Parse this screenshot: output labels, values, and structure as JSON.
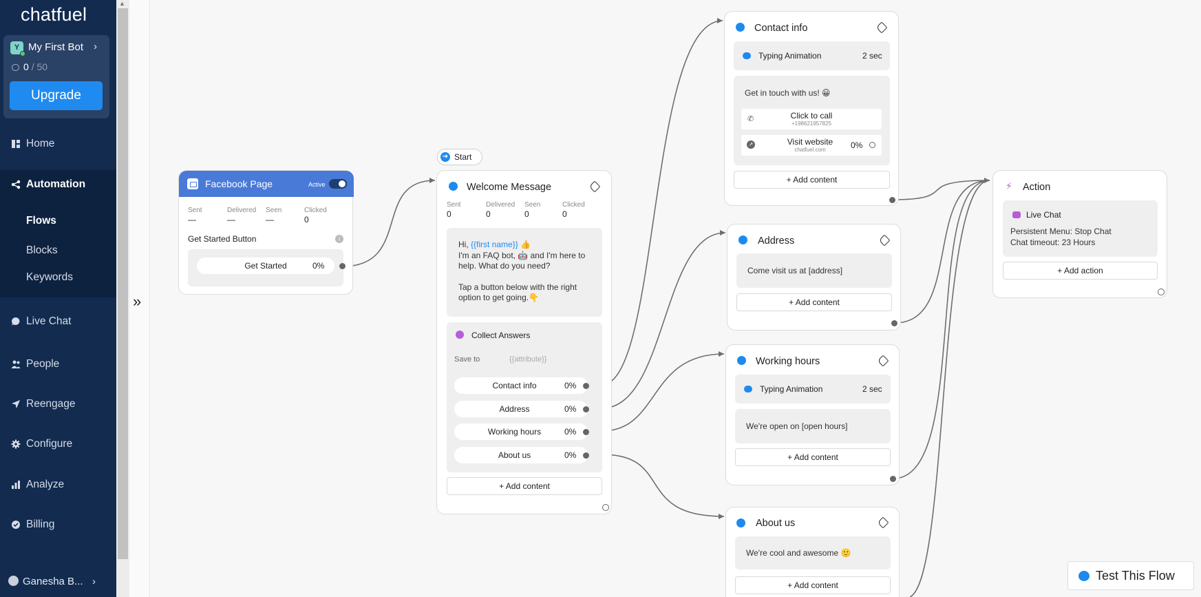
{
  "sidebar": {
    "logo": "chatfuel",
    "bot": {
      "avatar_letter": "Y",
      "name": "My First Bot",
      "messages_used": "0",
      "messages_limit": "/ 50"
    },
    "upgrade_label": "Upgrade",
    "nav": {
      "home": "Home",
      "automation": "Automation",
      "flows": "Flows",
      "blocks": "Blocks",
      "keywords": "Keywords",
      "live_chat": "Live Chat",
      "people": "People",
      "reengage": "Reengage",
      "configure": "Configure",
      "analyze": "Analyze",
      "billing": "Billing"
    },
    "user_name": "Ganesha B..."
  },
  "facebook_card": {
    "title": "Facebook Page",
    "status": "Active",
    "stats": {
      "sent_label": "Sent",
      "sent": "—",
      "delivered_label": "Delivered",
      "delivered": "—",
      "seen_label": "Seen",
      "seen": "—",
      "clicked_label": "Clicked",
      "clicked": "0"
    },
    "section_title": "Get Started Button",
    "button_label": "Get Started",
    "button_pct": "0%"
  },
  "start_chip": "Start",
  "welcome_card": {
    "title": "Welcome Message",
    "stats": {
      "sent_label": "Sent",
      "sent": "0",
      "delivered_label": "Delivered",
      "delivered": "0",
      "seen_label": "Seen",
      "seen": "0",
      "clicked_label": "Clicked",
      "clicked": "0"
    },
    "msg_line1_pre": "Hi, ",
    "msg_line1_var": "{{first name}}",
    "msg_line1_emoji": "👍",
    "msg_line2": "I'm an FAQ bot, 🤖 and I'm here to",
    "msg_line3": "help. What do you need?",
    "msg_line4": "Tap a button below with the right",
    "msg_line5": "option to get going.👇",
    "collect_title": "Collect Answers",
    "save_to_label": "Save to",
    "save_to_placeholder": "{{attribute}}",
    "buttons": [
      {
        "label": "Contact info",
        "pct": "0%"
      },
      {
        "label": "Address",
        "pct": "0%"
      },
      {
        "label": "Working hours",
        "pct": "0%"
      },
      {
        "label": "About us",
        "pct": "0%"
      }
    ],
    "add_content": "+ Add content"
  },
  "contact_card": {
    "title": "Contact info",
    "typing_label": "Typing Animation",
    "typing_time": "2 sec",
    "message": "Get in touch with us! 😀",
    "call_label": "Click to call",
    "call_number": "+198621957825",
    "website_label": "Visit website",
    "website_url": "chatfuel.com",
    "website_pct": "0%",
    "add_content": "+ Add content"
  },
  "address_card": {
    "title": "Address",
    "message": "Come visit us at [address]",
    "add_content": "+ Add content"
  },
  "hours_card": {
    "title": "Working hours",
    "typing_label": "Typing Animation",
    "typing_time": "2 sec",
    "message": "We're open on [open hours]",
    "add_content": "+ Add content"
  },
  "about_card": {
    "title": "About us",
    "message": "We're cool and awesome 🙂",
    "add_content": "+ Add content"
  },
  "action_card": {
    "title": "Action",
    "live_chat_label": "Live Chat",
    "line1": "Persistent Menu: Stop Chat",
    "line2": "Chat timeout: 23 Hours",
    "add_action": "+ Add action"
  },
  "test_button": "Test This Flow",
  "colors": {
    "sidebar_bg": "#122b4f",
    "accent_blue": "#1d8af0",
    "fb_header": "#4a7ad8",
    "live_chat_purple": "#b65ed8"
  }
}
